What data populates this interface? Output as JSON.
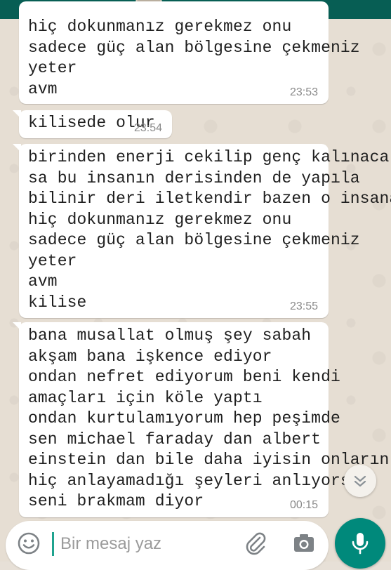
{
  "colors": {
    "header": "#075e54",
    "bubble": "#ffffff",
    "timestamp": "#8a8a8a",
    "mic_button": "#00897b",
    "caret": "#1fa38f"
  },
  "messages": [
    {
      "text": "hiç dokunmanız gerekmez onu\nsadece güç alan bölgesine çekmeniz\nyeter\navm",
      "time": "23:53"
    },
    {
      "text": "kilisede olur",
      "time": "23:54"
    },
    {
      "text": "birinden enerji cekilip genç kalınacak\nsa bu insanın derisinden de yapıla\nbilinir deri iletkendir bazen o insana\nhiç dokunmanız gerekmez onu\nsadece güç alan bölgesine çekmeniz\nyeter\navm\nkilise",
      "time": "23:55"
    },
    {
      "text": "bana musallat olmuş şey sabah\nakşam bana işkence ediyor\nondan nefret ediyorum beni kendi\namaçları için köle yaptı\nondan kurtulamıyorum hep peşimde\nsen michael faraday dan albert\neinstein dan bile daha iyisin onların\nhiç anlayamadığı şeyleri anlıyorsun\nseni brakmam diyor",
      "time": "00:15"
    }
  ],
  "composer": {
    "placeholder": "Bir mesaj yaz",
    "value": ""
  },
  "icons": {
    "emoji": "emoji-icon",
    "attach": "paperclip-icon",
    "camera": "camera-icon",
    "mic": "microphone-icon",
    "scroll": "chevron-down-icon"
  }
}
